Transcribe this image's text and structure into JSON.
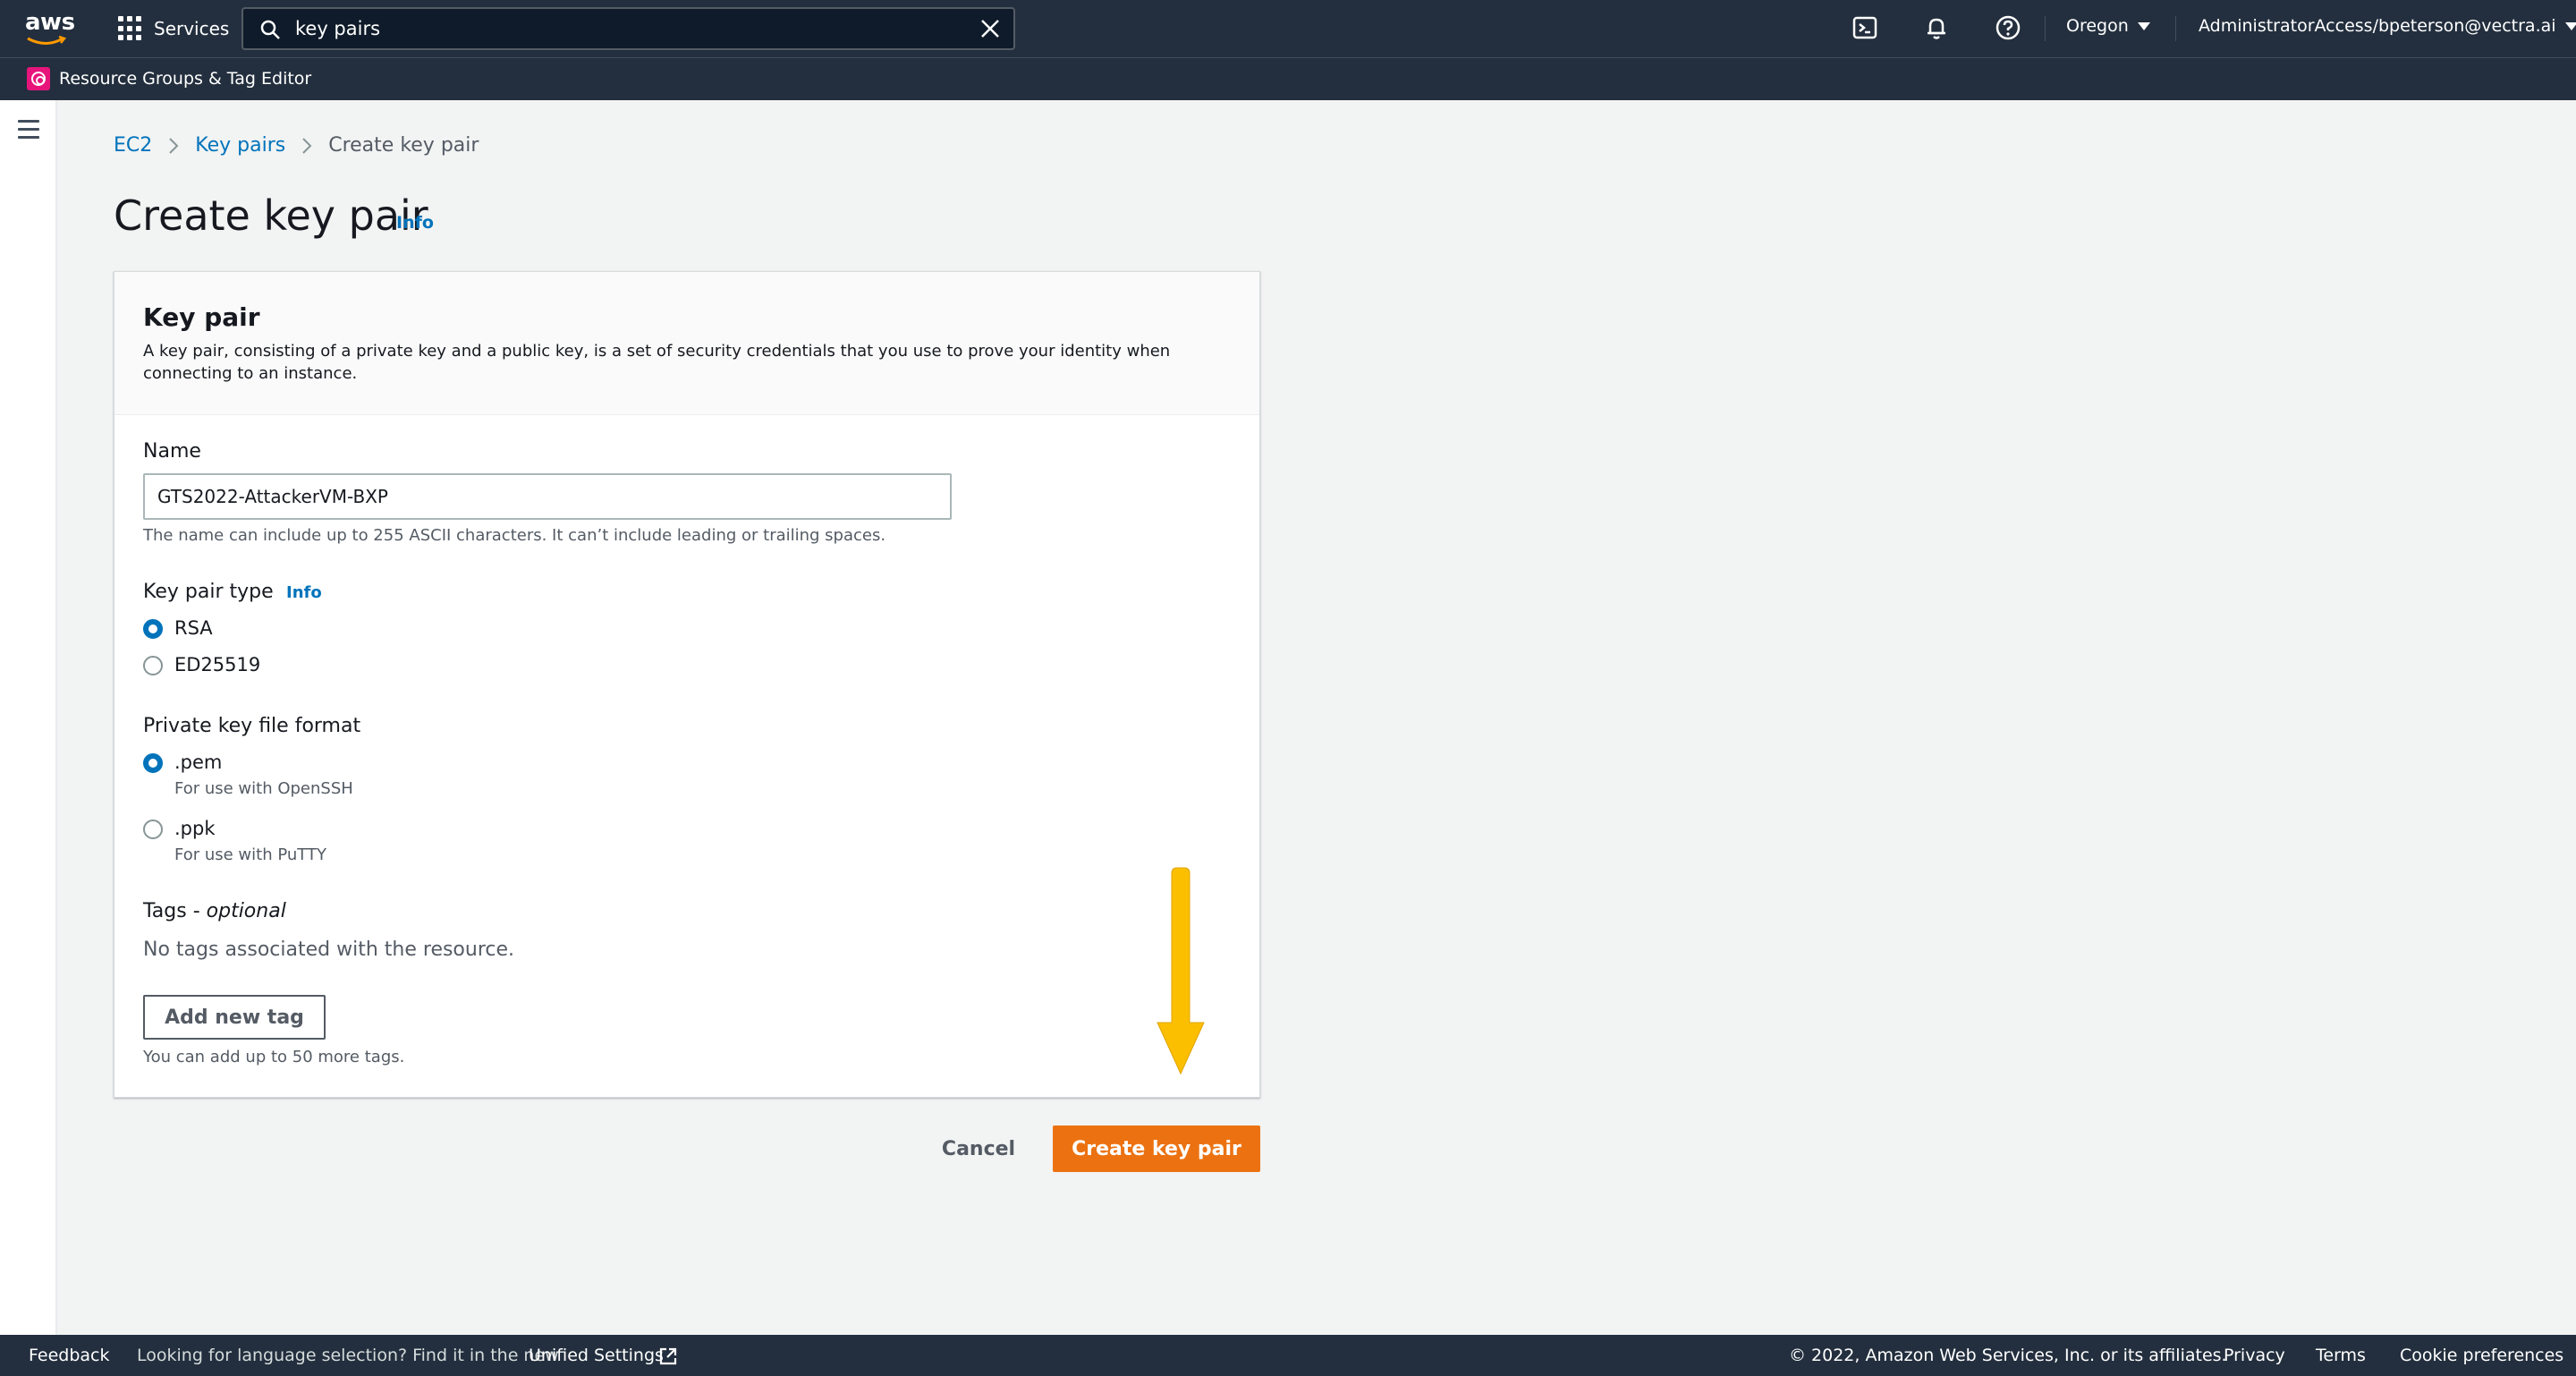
{
  "topnav": {
    "logo_text": "aws",
    "services_label": "Services",
    "search": {
      "value": "key pairs",
      "placeholder": "Search"
    },
    "region": "Oregon",
    "account": "AdministratorAccess/bpeterson@vectra.ai"
  },
  "subnav": {
    "resource_groups_label": "Resource Groups & Tag Editor"
  },
  "breadcrumb": {
    "items": [
      "EC2",
      "Key pairs"
    ],
    "current": "Create key pair"
  },
  "page": {
    "title": "Create key pair",
    "info": "Info"
  },
  "panel": {
    "title": "Key pair",
    "description": "A key pair, consisting of a private key and a public key, is a set of security credentials that you use to prove your identity when connecting to an instance.",
    "name_label": "Name",
    "name_value": "GTS2022-AttackerVM-BXP",
    "name_hint": "The name can include up to 255 ASCII characters. It can’t include leading or trailing spaces.",
    "type_label": "Key pair type",
    "type_info": "Info",
    "type_options": [
      "RSA",
      "ED25519"
    ],
    "format_label": "Private key file format",
    "format_options": [
      {
        "label": ".pem",
        "desc": "For use with OpenSSH"
      },
      {
        "label": ".ppk",
        "desc": "For use with PuTTY"
      }
    ],
    "tags_label": "Tags -",
    "tags_optional": "optional",
    "tags_empty": "No tags associated with the resource.",
    "add_tag_label": "Add new tag",
    "tags_hint": "You can add up to 50 more tags."
  },
  "actions": {
    "cancel": "Cancel",
    "create": "Create key pair"
  },
  "footer": {
    "feedback": "Feedback",
    "lang_text": "Looking for language selection? Find it in the new",
    "unified_settings": "Unified Settings",
    "copyright": "© 2022, Amazon Web Services, Inc. or its affiliates.",
    "privacy": "Privacy",
    "terms": "Terms",
    "cookies": "Cookie preferences"
  },
  "colors": {
    "primary_button": "#ec7211",
    "link": "#0073bb",
    "nav_bg": "#232f3e",
    "annotation_arrow": "#fbbf00"
  }
}
